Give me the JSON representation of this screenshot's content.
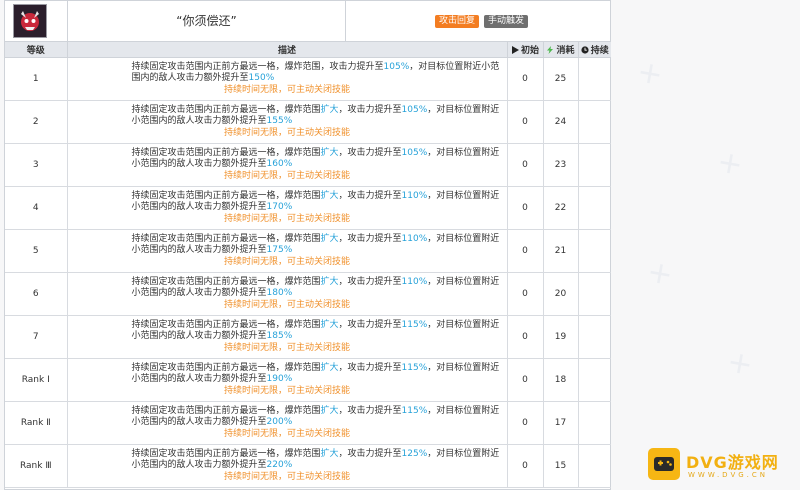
{
  "skill": {
    "name": "“你须偿还”",
    "tags": [
      {
        "label": "攻击回复",
        "color": "#f37d22"
      },
      {
        "label": "手动触发",
        "color": "#6f6f6f"
      }
    ]
  },
  "columns": {
    "level": "等级",
    "desc": "描述",
    "initial": "初始",
    "cost": "消耗",
    "duration": "持续"
  },
  "colors": {
    "highlight": "#27a2d9",
    "note": "#f0912c",
    "tag_attack": "#f37d22",
    "tag_manual": "#6f6f6f"
  },
  "rows": [
    {
      "level": "1",
      "p1": "持续固定攻击范围内正前方最远一格，爆炸范围",
      "p1b": "",
      "p2": "，攻击力提升至",
      "atk": "105%",
      "p3": "，对目标位置附近小范围内的敌人攻击力额外提升至",
      "extra": "150%",
      "note": "持续时间无限，可主动关闭技能",
      "initial": "0",
      "cost": "25",
      "duration": ""
    },
    {
      "level": "2",
      "p1": "持续固定攻击范围内正前方最远一格，爆炸范围",
      "p1b": "扩大",
      "p2": "，攻击力提升至",
      "atk": "105%",
      "p3": "，对目标位置附近小范围内的敌人攻击力额外提升至",
      "extra": "155%",
      "note": "持续时间无限，可主动关闭技能",
      "initial": "0",
      "cost": "24",
      "duration": ""
    },
    {
      "level": "3",
      "p1": "持续固定攻击范围内正前方最远一格，爆炸范围",
      "p1b": "扩大",
      "p2": "，攻击力提升至",
      "atk": "105%",
      "p3": "，对目标位置附近小范围内的敌人攻击力额外提升至",
      "extra": "160%",
      "note": "持续时间无限，可主动关闭技能",
      "initial": "0",
      "cost": "23",
      "duration": ""
    },
    {
      "level": "4",
      "p1": "持续固定攻击范围内正前方最远一格，爆炸范围",
      "p1b": "扩大",
      "p2": "，攻击力提升至",
      "atk": "110%",
      "p3": "，对目标位置附近小范围内的敌人攻击力额外提升至",
      "extra": "170%",
      "note": "持续时间无限，可主动关闭技能",
      "initial": "0",
      "cost": "22",
      "duration": ""
    },
    {
      "level": "5",
      "p1": "持续固定攻击范围内正前方最远一格，爆炸范围",
      "p1b": "扩大",
      "p2": "，攻击力提升至",
      "atk": "110%",
      "p3": "，对目标位置附近小范围内的敌人攻击力额外提升至",
      "extra": "175%",
      "note": "持续时间无限，可主动关闭技能",
      "initial": "0",
      "cost": "21",
      "duration": ""
    },
    {
      "level": "6",
      "p1": "持续固定攻击范围内正前方最远一格，爆炸范围",
      "p1b": "扩大",
      "p2": "，攻击力提升至",
      "atk": "110%",
      "p3": "，对目标位置附近小范围内的敌人攻击力额外提升至",
      "extra": "180%",
      "note": "持续时间无限，可主动关闭技能",
      "initial": "0",
      "cost": "20",
      "duration": ""
    },
    {
      "level": "7",
      "p1": "持续固定攻击范围内正前方最远一格，爆炸范围",
      "p1b": "扩大",
      "p2": "，攻击力提升至",
      "atk": "115%",
      "p3": "，对目标位置附近小范围内的敌人攻击力额外提升至",
      "extra": "185%",
      "note": "持续时间无限，可主动关闭技能",
      "initial": "0",
      "cost": "19",
      "duration": ""
    },
    {
      "level": "Rank Ⅰ",
      "p1": "持续固定攻击范围内正前方最远一格，爆炸范围",
      "p1b": "扩大",
      "p2": "，攻击力提升至",
      "atk": "115%",
      "p3": "，对目标位置附近小范围内的敌人攻击力额外提升至",
      "extra": "190%",
      "note": "持续时间无限，可主动关闭技能",
      "initial": "0",
      "cost": "18",
      "duration": ""
    },
    {
      "level": "Rank Ⅱ",
      "p1": "持续固定攻击范围内正前方最远一格，爆炸范围",
      "p1b": "扩大",
      "p2": "，攻击力提升至",
      "atk": "115%",
      "p3": "，对目标位置附近小范围内的敌人攻击力额外提升至",
      "extra": "200%",
      "note": "持续时间无限，可主动关闭技能",
      "initial": "0",
      "cost": "17",
      "duration": ""
    },
    {
      "level": "Rank Ⅲ",
      "p1": "持续固定攻击范围内正前方最远一格，爆炸范围",
      "p1b": "扩大",
      "p2": "，攻击力提升至",
      "atk": "125%",
      "p3": "，对目标位置附近小范围内的敌人攻击力额外提升至",
      "extra": "220%",
      "note": "持续时间无限，可主动关闭技能",
      "initial": "0",
      "cost": "15",
      "duration": ""
    }
  ],
  "brand": {
    "name": "DVG游戏网",
    "url": "WWW.DVG.CN"
  }
}
